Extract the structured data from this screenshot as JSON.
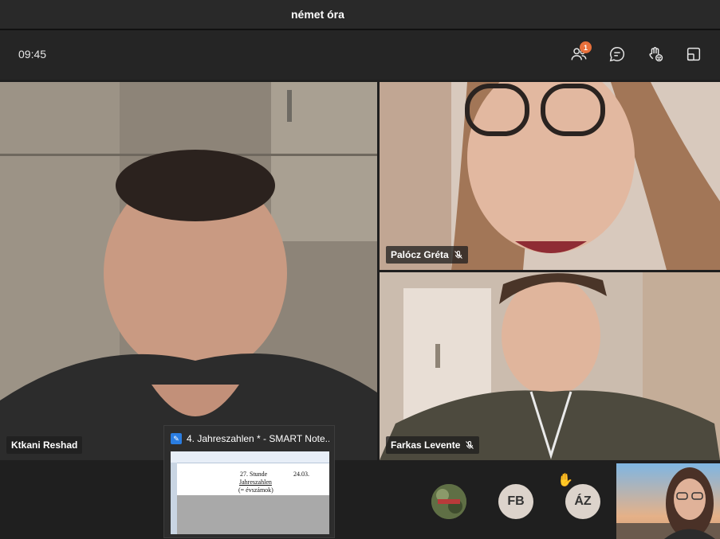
{
  "window": {
    "title": "német óra"
  },
  "toolbar": {
    "time": "09:45",
    "participants_badge": "1"
  },
  "participants": [
    {
      "name": "Ktkani Reshad"
    },
    {
      "name": "Palócz Gréta"
    },
    {
      "name": "Farkas Levente"
    }
  ],
  "shared_window": {
    "title": "4. Jahreszahlen * - SMART Note...",
    "slide_line1": "27. Stunde",
    "slide_date": "24.03.",
    "slide_line2": "Jahreszahlen",
    "slide_line3": "(= évszámok)"
  },
  "bottom_row": {
    "avatar_fb": "FB",
    "avatar_az": "ÁZ"
  }
}
